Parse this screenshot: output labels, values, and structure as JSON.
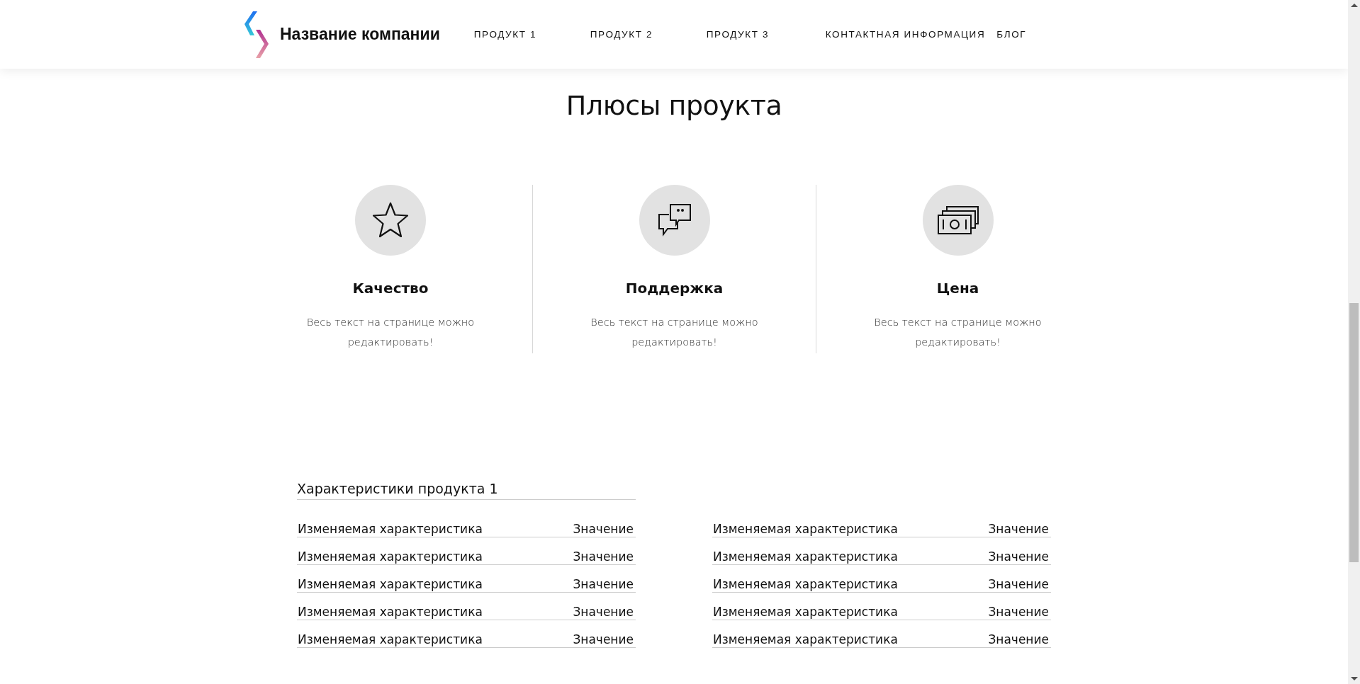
{
  "header": {
    "company_name": "Название компании",
    "nav": [
      {
        "label": "ПРОДУКТ 1"
      },
      {
        "label": "ПРОДУКТ 2"
      },
      {
        "label": "ПРОДУКТ 3"
      },
      {
        "label": "КОНТАКТНАЯ ИНФОРМАЦИЯ"
      },
      {
        "label": "БЛОГ"
      }
    ]
  },
  "advantages": {
    "title": "Плюсы проукта",
    "items": [
      {
        "kind": "star",
        "title": "Качество",
        "text": "Весь текст на странице можно редактировать!"
      },
      {
        "kind": "chat",
        "title": "Поддержка",
        "text": "Весь текст на странице можно редактировать!"
      },
      {
        "kind": "money",
        "title": "Цена",
        "text": "Весь текст на странице можно редактировать!"
      }
    ]
  },
  "specs": {
    "title": "Характеристики продукта 1",
    "columns": [
      [
        {
          "name": "Изменяемая характеристика",
          "value": "Значение"
        },
        {
          "name": "Изменяемая характеристика",
          "value": "Значение"
        },
        {
          "name": "Изменяемая характеристика",
          "value": "Значение"
        },
        {
          "name": "Изменяемая характеристика",
          "value": "Значение"
        },
        {
          "name": "Изменяемая характеристика",
          "value": "Значение"
        }
      ],
      [
        {
          "name": "Изменяемая характеристика",
          "value": "Значение"
        },
        {
          "name": "Изменяемая характеристика",
          "value": "Значение"
        },
        {
          "name": "Изменяемая характеристика",
          "value": "Значение"
        },
        {
          "name": "Изменяемая характеристика",
          "value": "Значение"
        },
        {
          "name": "Изменяемая характеристика",
          "value": "Значение"
        }
      ]
    ]
  }
}
